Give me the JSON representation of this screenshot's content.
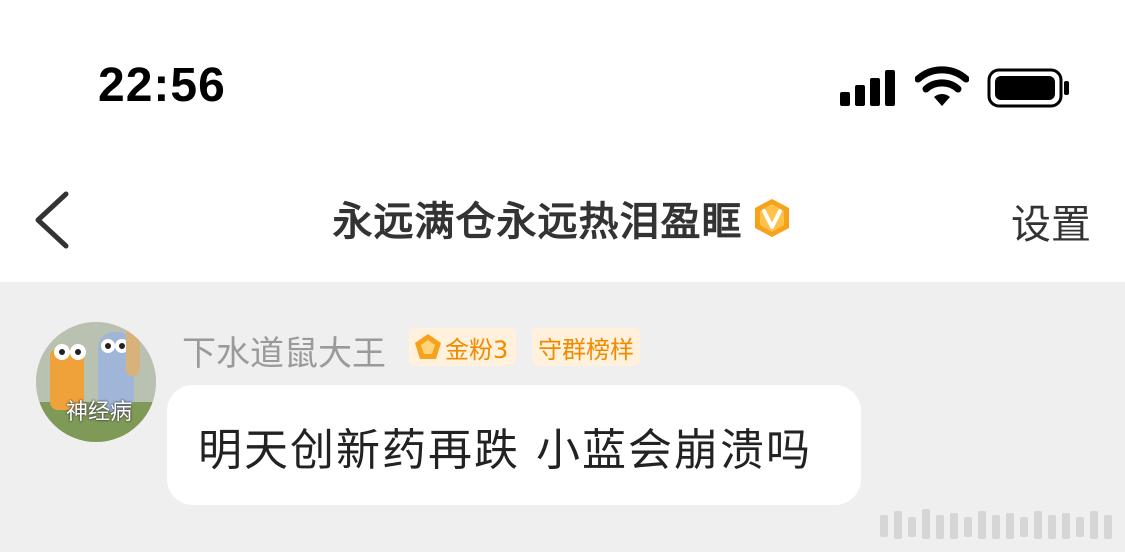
{
  "status_bar": {
    "time": "22:56",
    "icons": [
      "cellular-signal-icon",
      "wifi-icon",
      "battery-icon"
    ]
  },
  "nav": {
    "back_icon": "chevron-left-icon",
    "title": "永远满仓永远热泪盈眶",
    "verified_icon": "verified-v-badge-icon",
    "settings_label": "设置"
  },
  "message": {
    "sender_name": "下水道鼠大王",
    "fan_badge": "金粉3",
    "fan_badge_icon": "pentagon-badge-icon",
    "role_badge": "守群榜样",
    "avatar_text": "神经病",
    "text": "明天创新药再跌 小蓝会崩溃吗"
  },
  "colors": {
    "badge_orange": "#f08a00",
    "badge_bg": "#fff1dc",
    "chat_bg": "#efefef",
    "verified_orange": "#f7a21b"
  }
}
